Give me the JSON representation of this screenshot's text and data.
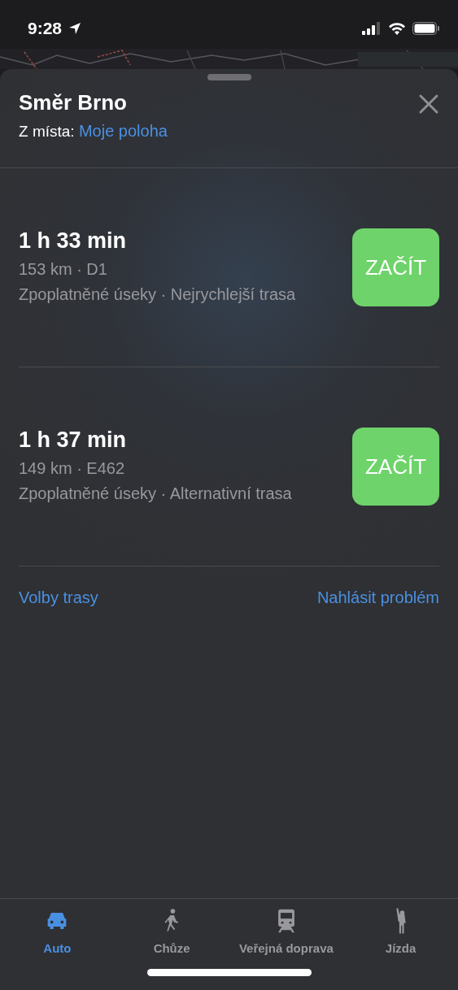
{
  "status_bar": {
    "time": "9:28"
  },
  "sheet": {
    "title": "Směr Brno",
    "origin_label": "Z místa:",
    "origin_value": "Moje poloha"
  },
  "routes": [
    {
      "duration": "1 h 33 min",
      "distance": "153 km · D1",
      "details": "Zpoplatněné úseky · Nejrychlejší trasa",
      "button": "ZAČÍT"
    },
    {
      "duration": "1 h 37 min",
      "distance": "149 km · E462",
      "details": "Zpoplatněné úseky · Alternativní trasa",
      "button": "ZAČÍT"
    }
  ],
  "links": [
    "Volby trasy",
    "Nahlásit problém"
  ],
  "tabs": [
    {
      "kind": "car",
      "label": "Auto",
      "selected": true
    },
    {
      "kind": "walk",
      "label": "Chůze",
      "selected": false
    },
    {
      "kind": "train",
      "label": "Veřejná doprava",
      "selected": false
    },
    {
      "kind": "ride",
      "label": "Jízda",
      "selected": false
    }
  ]
}
